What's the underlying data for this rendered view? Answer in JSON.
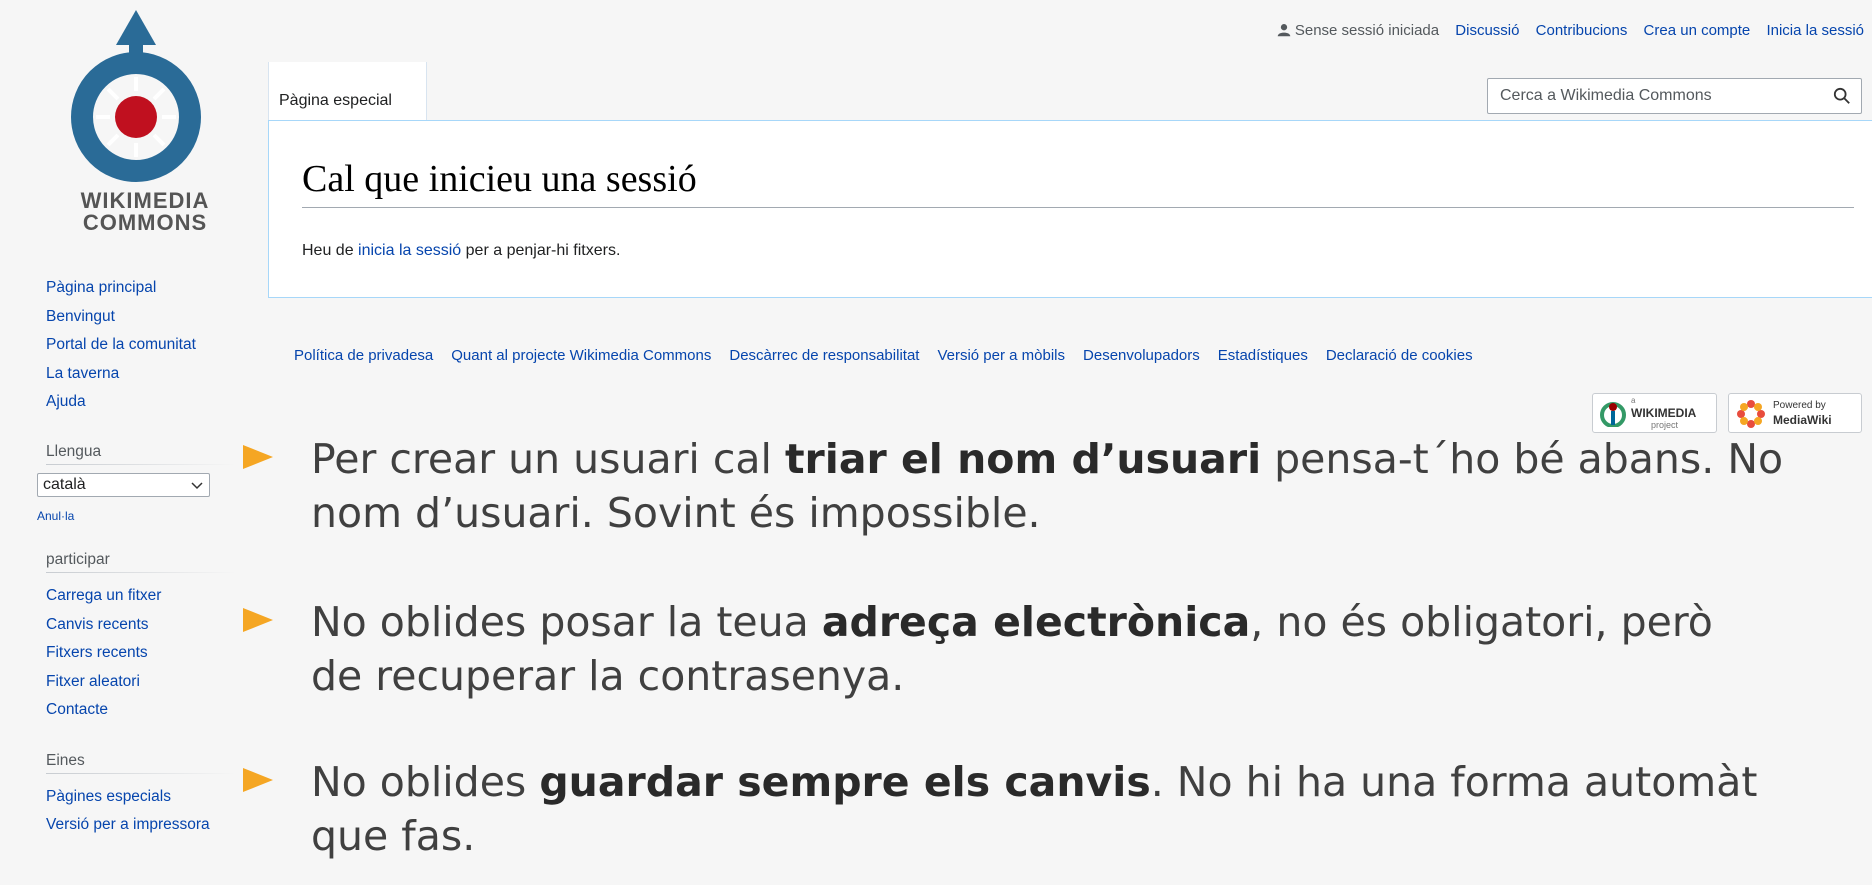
{
  "personal": {
    "status": "Sense sessió iniciada",
    "links": [
      "Discussió",
      "Contribucions",
      "Crea un compte",
      "Inicia la sessió"
    ]
  },
  "logo": {
    "line1": "WIKIMEDIA",
    "line2": "COMMONS"
  },
  "tab": {
    "label": "Pàgina especial"
  },
  "search": {
    "placeholder": "Cerca a Wikimedia Commons",
    "icon": "search-icon"
  },
  "content": {
    "title": "Cal que inicieu una sessió",
    "text_before": "Heu de ",
    "link": "inicia la sessió",
    "text_after": " per a penjar-hi fitxers."
  },
  "sidebar": {
    "navigation": [
      "Pàgina principal",
      "Benvingut",
      "Portal de la comunitat",
      "La taverna",
      "Ajuda"
    ],
    "language_heading": "Llengua",
    "language_selected": "català",
    "undo": "Anul·la",
    "participate_heading": "participar",
    "participate": [
      "Carrega un fitxer",
      "Canvis recents",
      "Fitxers recents",
      "Fitxer aleatori",
      "Contacte"
    ],
    "tools_heading": "Eines",
    "tools": [
      "Pàgines especials",
      "Versió per a impressora"
    ]
  },
  "footer": {
    "links": [
      "Política de privadesa",
      "Quant al projecte Wikimedia Commons",
      "Descàrrec de responsabilitat",
      "Versió per a mòbils",
      "Desenvolupadors",
      "Estadístiques",
      "Declaració de cookies"
    ],
    "wikimedia_badge": {
      "top": "a",
      "name": "WIKIMEDIA",
      "sub": "project"
    },
    "mediawiki_badge": {
      "top": "Powered by",
      "name": "MediaWiki"
    }
  },
  "overlay": {
    "bullet_color": "#f5a623",
    "b1": {
      "pre": "Per crear un usuari cal ",
      "bold": "triar el nom d’usuari",
      "post": " pensa-t´ho bé abans. No",
      "line2": "nom d’usuari. Sovint és impossible."
    },
    "b2": {
      "pre": "No oblides posar la teua ",
      "bold": "adreça electrònica",
      "post": ", no és obligatori, però",
      "line2": "de recuperar la contrasenya."
    },
    "b3": {
      "pre": "No oblides ",
      "bold": "guardar sempre els canvis",
      "post": ". No hi ha una forma automàt",
      "line2": "que fas."
    }
  }
}
